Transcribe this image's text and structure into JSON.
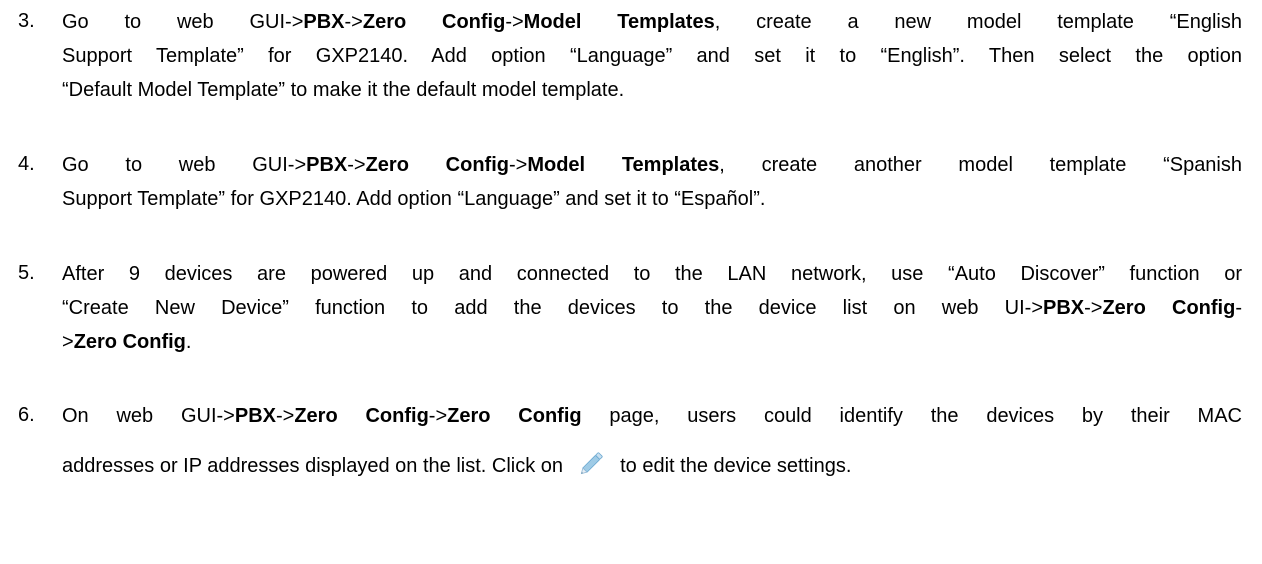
{
  "steps": [
    {
      "number": "3.",
      "lines": [
        {
          "parts": [
            "Go to web GUI->",
            "PBX",
            "->",
            "Zero Config",
            "->",
            "Model Templates",
            ", create a new model template “English"
          ]
        },
        {
          "parts": [
            "Support Template” for GXP2140. Add option “Language” and set it to “English”. Then select the option"
          ]
        },
        {
          "parts": [
            "“Default Model Template” to make it the default model template."
          ]
        }
      ]
    },
    {
      "number": "4.",
      "lines": [
        {
          "parts": [
            "Go to web GUI->",
            "PBX",
            "->",
            "Zero Config",
            "->",
            "Model Templates",
            ", create another model template “Spanish"
          ]
        },
        {
          "parts": [
            "Support Template” for GXP2140. Add option “Language” and set it to “Español”."
          ]
        }
      ]
    },
    {
      "number": "5.",
      "lines": [
        {
          "parts": [
            "After 9 devices are powered up and connected to the LAN network, use “Auto Discover” function or"
          ]
        },
        {
          "parts": [
            "“Create New Device” function to add the devices to the device list on web UI->",
            "PBX",
            "->",
            "Zero Config",
            "-"
          ]
        },
        {
          "parts": [
            ">",
            "Zero Config",
            "."
          ]
        }
      ]
    },
    {
      "number": "6.",
      "lines": [
        {
          "parts": [
            "On web GUI->",
            "PBX",
            "->",
            "Zero Config",
            "->",
            "Zero Config",
            " page, users could identify the devices by their MAC"
          ]
        },
        {
          "parts": [
            "addresses or IP addresses displayed on the list. Click on ",
            " to edit the device settings."
          ]
        }
      ]
    }
  ],
  "icons": {
    "edit": "pencil-edit-icon"
  }
}
